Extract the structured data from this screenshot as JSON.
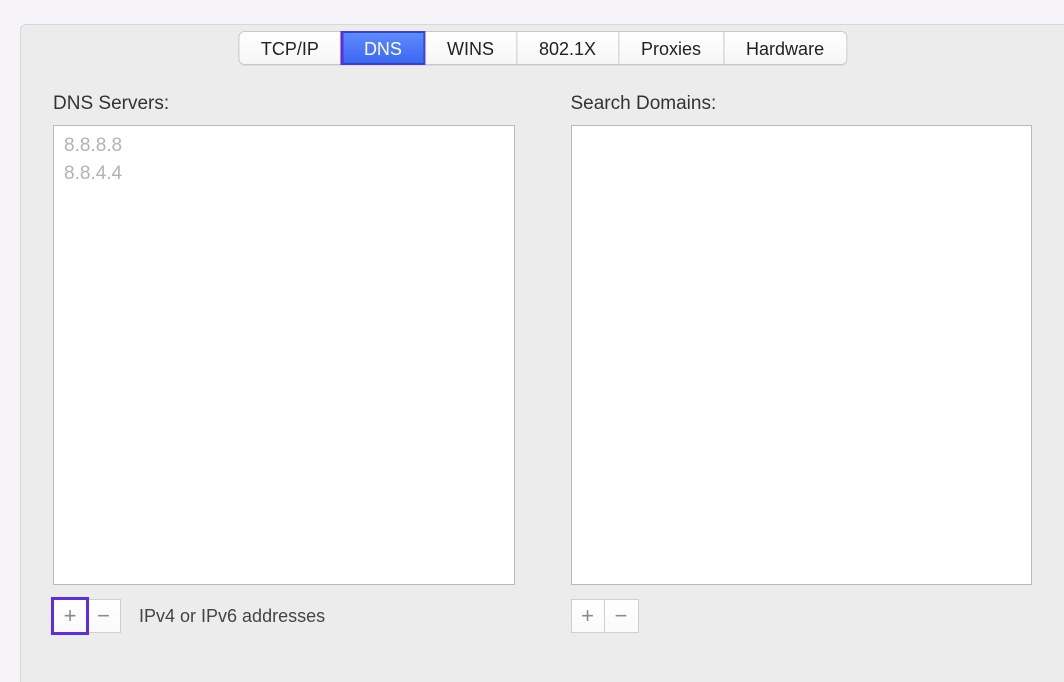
{
  "tabs": [
    {
      "label": "TCP/IP",
      "active": false
    },
    {
      "label": "DNS",
      "active": true
    },
    {
      "label": "WINS",
      "active": false
    },
    {
      "label": "802.1X",
      "active": false
    },
    {
      "label": "Proxies",
      "active": false
    },
    {
      "label": "Hardware",
      "active": false
    }
  ],
  "dns": {
    "label": "DNS Servers:",
    "servers": [
      "8.8.8.8",
      "8.8.4.4"
    ],
    "hint": "IPv4 or IPv6 addresses"
  },
  "domains": {
    "label": "Search Domains:",
    "items": []
  },
  "buttons": {
    "plus": "+",
    "minus": "−"
  }
}
